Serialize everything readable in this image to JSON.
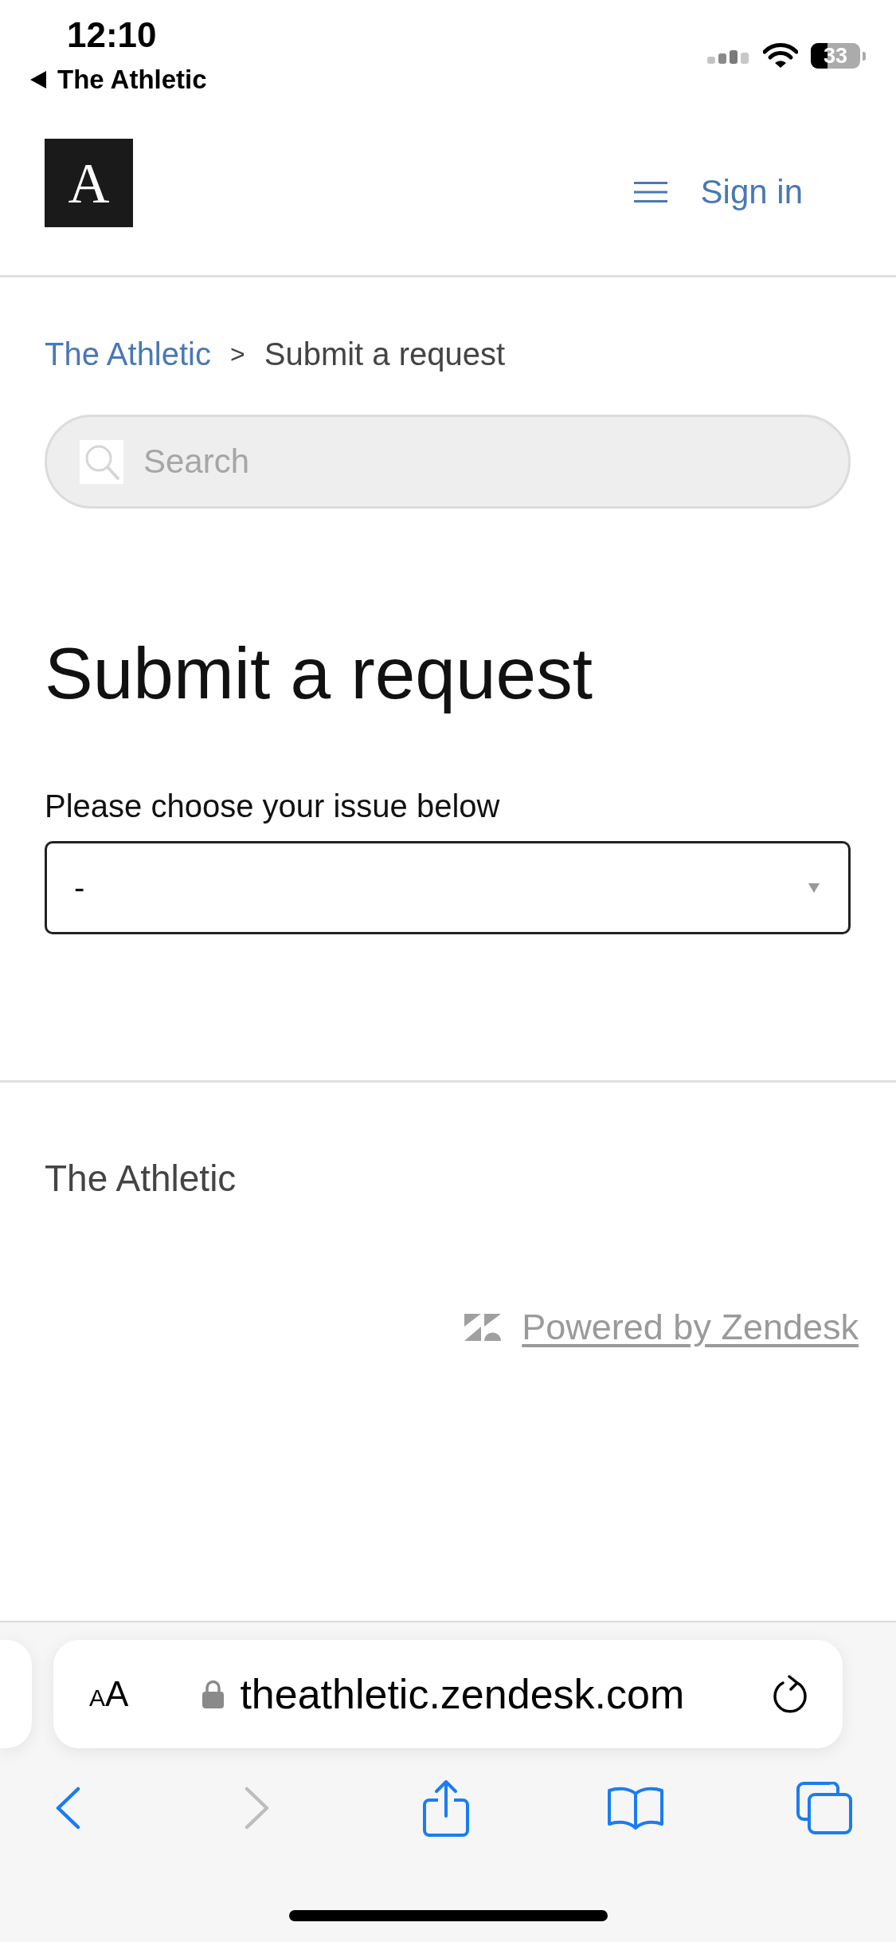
{
  "status_bar": {
    "time": "12:10",
    "back_to_app": "The Athletic",
    "battery_percent": "33"
  },
  "header": {
    "logo_letter": "A",
    "sign_in": "Sign in"
  },
  "breadcrumb": [
    {
      "label": "The Athletic",
      "kind": "link"
    },
    {
      "label": ">",
      "kind": "separator"
    },
    {
      "label": "Submit a request",
      "kind": "current"
    }
  ],
  "search": {
    "placeholder": "Search"
  },
  "page_title": "Submit a request",
  "issue_select": {
    "label": "Please choose your issue below",
    "value": "-"
  },
  "footer": {
    "brand": "The Athletic",
    "powered_by": "Powered by Zendesk"
  },
  "browser": {
    "text_size": {
      "small": "A",
      "large": "A"
    },
    "url": "theathletic.zendesk.com",
    "toolbar": [
      {
        "kind": "back",
        "disabled": false
      },
      {
        "kind": "forward",
        "disabled": true
      },
      {
        "kind": "share",
        "disabled": false
      },
      {
        "kind": "bookmarks",
        "disabled": false
      },
      {
        "kind": "tabs",
        "disabled": false
      }
    ]
  }
}
